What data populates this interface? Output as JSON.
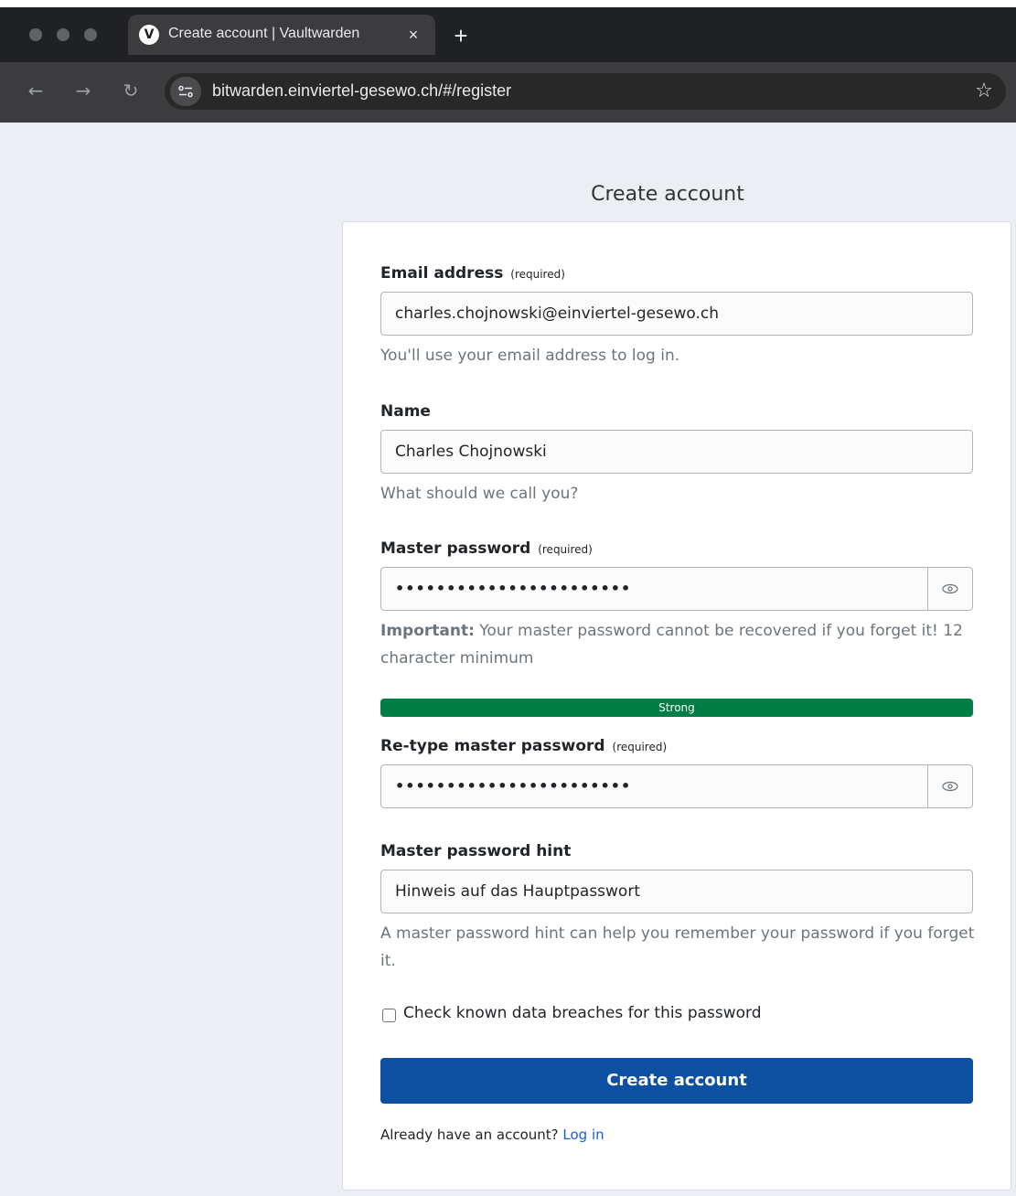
{
  "browser": {
    "tab_title": "Create account | Vaultwarden",
    "tab_close": "×",
    "new_tab": "+",
    "url": "bitwarden.einviertel-gesewo.ch/#/register",
    "icons": [
      "vaultwarden-logo-icon",
      "close-icon",
      "plus-icon",
      "back-icon",
      "forward-icon",
      "reload-icon",
      "site-info-icon",
      "bookmark-star-icon"
    ]
  },
  "form": {
    "title": "Create account",
    "email": {
      "label": "Email address",
      "required": "(required)",
      "value": "charles.chojnowski@einviertel-gesewo.ch",
      "help": "You'll use your email address to log in."
    },
    "name": {
      "label": "Name",
      "value": "Charles Chojnowski",
      "help": "What should we call you?"
    },
    "master_password": {
      "label": "Master password",
      "required": "(required)",
      "value": "•••••••••••••••••••••••",
      "help_bold": "Important:",
      "help": " Your master password cannot be recovered if you forget it! 12 character minimum"
    },
    "strength": {
      "label": "Strong",
      "level": 1.0,
      "color": "#017e45"
    },
    "retype_password": {
      "label": "Re-type master password",
      "required": "(required)",
      "value": "•••••••••••••••••••••••"
    },
    "hint": {
      "label": "Master password hint",
      "value": "Hinweis auf das Hauptpasswort",
      "help": "A master password hint can help you remember your password if you forget it."
    },
    "breach_check": {
      "label": "Check known data breaches for this password",
      "checked": false
    },
    "submit_label": "Create account",
    "login_prompt": "Already have an account?",
    "login_link": "Log in"
  },
  "colors": {
    "primary_button": "#0d4fa0",
    "link": "#175ddc",
    "page_background": "#ebeef3"
  }
}
